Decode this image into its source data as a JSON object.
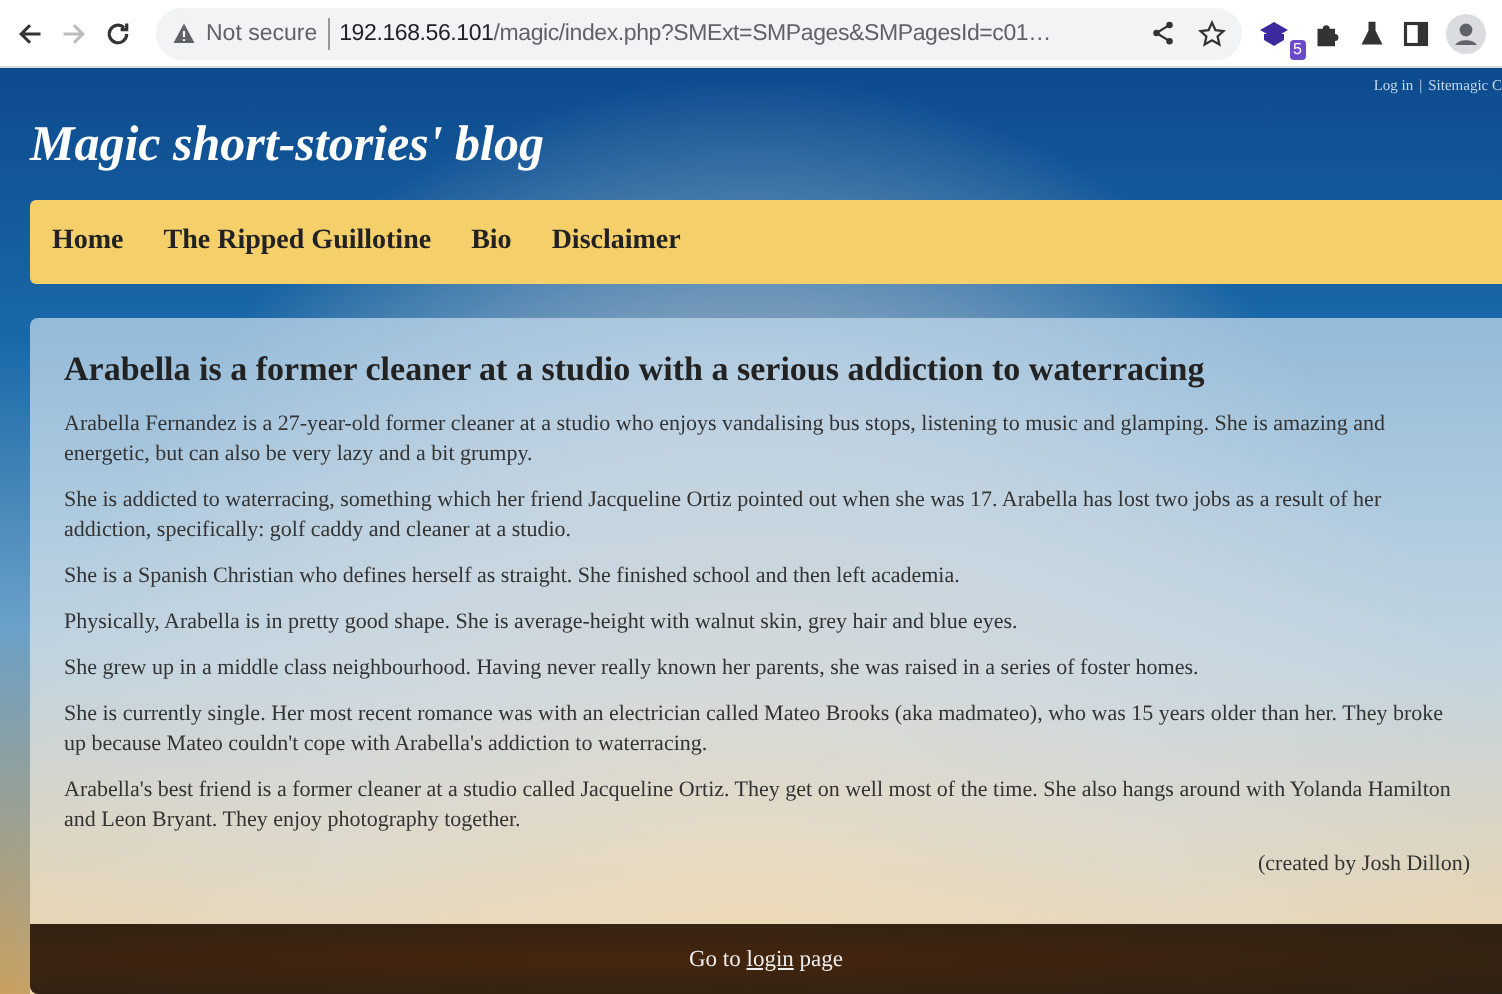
{
  "browser": {
    "back_disabled": false,
    "forward_disabled": true,
    "security": "Not secure",
    "url_host": "192.168.56.101",
    "url_path": "/magic/index.php?SMExt=SMPages&SMPagesId=c01…",
    "extension_badge": "5"
  },
  "top_links": [
    {
      "label": "Log in"
    },
    {
      "label": "Sitemagic C"
    }
  ],
  "top_links_separator": "|",
  "site_title": "Magic short-stories' blog",
  "nav": [
    {
      "label": "Home"
    },
    {
      "label": "The Ripped Guillotine"
    },
    {
      "label": "Bio"
    },
    {
      "label": "Disclaimer"
    }
  ],
  "article": {
    "heading": "Arabella is a former cleaner at a studio with a serious addiction to waterracing",
    "paragraphs": [
      "Arabella Fernandez is a 27-year-old former cleaner at a studio who enjoys vandalising bus stops, listening to music and glamping. She is amazing and energetic, but can also be very lazy and a bit grumpy.",
      "She is addicted to waterracing, something which her friend Jacqueline Ortiz pointed out when she was 17. Arabella has lost two jobs as a result of her addiction, specifically: golf caddy and cleaner at a studio.",
      "She is a Spanish Christian who defines herself as straight. She finished school and then left academia.",
      "Physically, Arabella is in pretty good shape. She is average-height with walnut skin, grey hair and blue eyes.",
      "She grew up in a middle class neighbourhood. Having never really known her parents, she was raised in a series of foster homes.",
      "She is currently single. Her most recent romance was with an electrician called Mateo Brooks (aka madmateo), who was 15 years older than her. They broke up because Mateo couldn't cope with Arabella's addiction to waterracing.",
      "Arabella's best friend is a former cleaner at a studio called Jacqueline Ortiz. They get on well most of the time. She also hangs around with Yolanda Hamilton and Leon Bryant. They enjoy photography together."
    ],
    "credit": "(created by Josh Dillon)"
  },
  "footer": {
    "before": "Go to",
    "link": "login",
    "after": "page"
  }
}
